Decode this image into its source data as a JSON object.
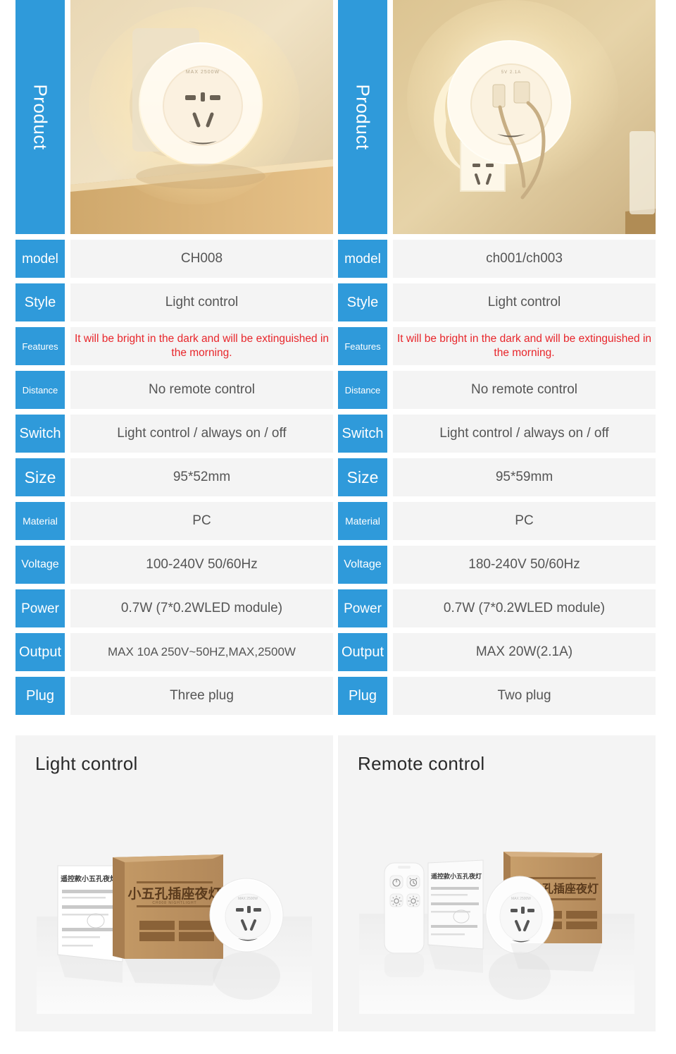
{
  "accent_color": "#2f9ada",
  "feature_text_color": "#e8262b",
  "value_text_color": "#555555",
  "panel_bg": "#f4f4f4",
  "columns": [
    {
      "product_label": "Product",
      "photo_name": "night-light-plugged-in-warm-wall",
      "specs": [
        {
          "key": "model",
          "value": "CH008"
        },
        {
          "key": "Style",
          "value": "Light control"
        },
        {
          "key": "Features",
          "value": "It will be bright in the dark and will be extinguished in the morning."
        },
        {
          "key": "Distance",
          "value": "No remote control"
        },
        {
          "key": "Switch",
          "value": "Light control / always on / off"
        },
        {
          "key": "Size",
          "value": "95*52mm"
        },
        {
          "key": "Material",
          "value": "PC"
        },
        {
          "key": "Voltage",
          "value": "100-240V 50/60Hz"
        },
        {
          "key": "Power",
          "value": "0.7W (7*0.2WLED module)"
        },
        {
          "key": "Output",
          "value": "MAX 10A 250V~50HZ,MAX,2500W"
        },
        {
          "key": "Plug",
          "value": "Three plug"
        }
      ]
    },
    {
      "product_label": "Product",
      "photo_name": "night-light-with-usb-cables-plugged-in",
      "specs": [
        {
          "key": "model",
          "value": "ch001/ch003"
        },
        {
          "key": "Style",
          "value": "Light control"
        },
        {
          "key": "Features",
          "value": "It will be bright in the dark and will be extinguished in the morning."
        },
        {
          "key": "Distance",
          "value": "No remote control"
        },
        {
          "key": "Switch",
          "value": "Light control / always on / off"
        },
        {
          "key": "Size",
          "value": "95*59mm"
        },
        {
          "key": "Material",
          "value": "PC"
        },
        {
          "key": "Voltage",
          "value": "180-240V 50/60Hz"
        },
        {
          "key": "Power",
          "value": "0.7W (7*0.2WLED module)"
        },
        {
          "key": "Output",
          "value": "MAX 20W(2.1A)"
        },
        {
          "key": "Plug",
          "value": "Two plug"
        }
      ]
    }
  ],
  "panels": [
    {
      "title": "Light control",
      "photo_name": "packaging-box-manual-and-night-light",
      "box_text_cn": "小五孔插座夜灯",
      "box_text_en": "CH008 NIGHTLIGHT",
      "manual_text_cn": "遥控款小五孔夜灯"
    },
    {
      "title": "Remote control",
      "photo_name": "remote-control-manual-night-light-and-box",
      "box_text_cn": "五孔插座夜灯",
      "manual_text_cn": "遥控款小五孔夜灯",
      "remote_buttons": [
        "power-icon",
        "timer-icon",
        "brightness-down-icon",
        "brightness-up-icon"
      ]
    }
  ]
}
